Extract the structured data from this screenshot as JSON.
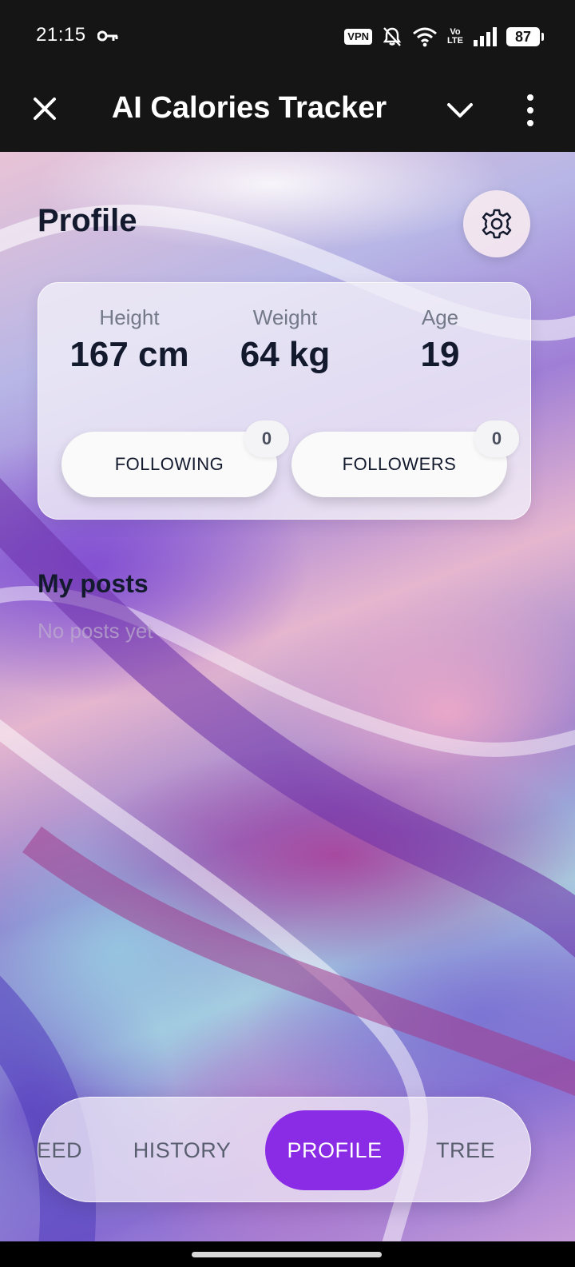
{
  "status_bar": {
    "time": "21:15",
    "vpn": "VPN",
    "volte_top": "Vo",
    "volte_bottom": "LTE",
    "battery": "87"
  },
  "app_bar": {
    "title": "AI Calories Tracker",
    "close_icon": "close-icon",
    "chevron_icon": "chevron-down-icon",
    "more_icon": "more-vertical-icon"
  },
  "profile": {
    "title": "Profile",
    "settings_icon": "gear-icon",
    "stats": {
      "height_label": "Height",
      "height_value": "167 cm",
      "weight_label": "Weight",
      "weight_value": "64 kg",
      "age_label": "Age",
      "age_value": "19"
    },
    "following": {
      "label": "FOLLOWING",
      "count": "0"
    },
    "followers": {
      "label": "FOLLOWERS",
      "count": "0"
    }
  },
  "posts": {
    "title": "My posts",
    "empty_text": "No posts yet"
  },
  "bottom_nav": {
    "items": [
      {
        "label": "EED"
      },
      {
        "label": "HISTORY"
      },
      {
        "label": "PROFILE"
      },
      {
        "label": "TREE"
      }
    ],
    "active_color": "#8a2be6"
  }
}
